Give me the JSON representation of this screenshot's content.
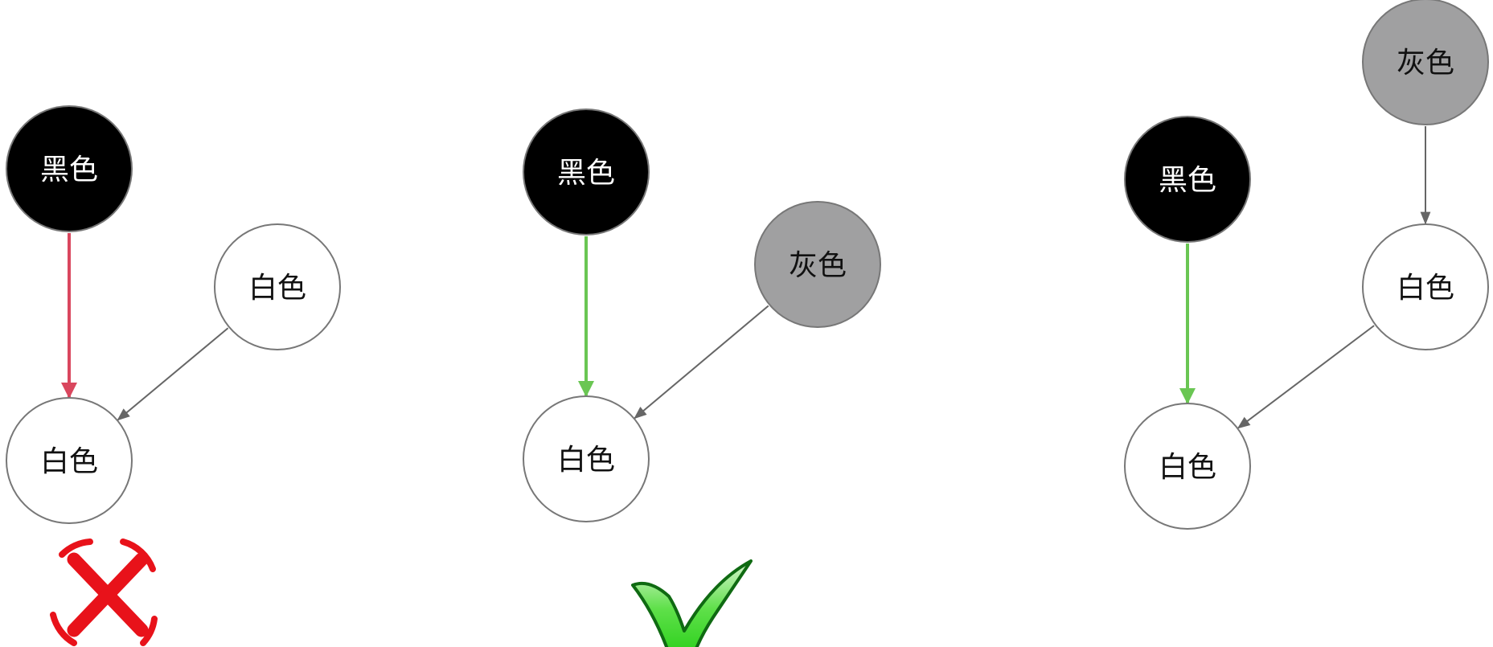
{
  "colors": {
    "black_node": "#000000",
    "white_node": "#ffffff",
    "gray_node": "#a0a0a1",
    "node_stroke": "#777777",
    "edge_gray": "#666666",
    "edge_red": "#d9475e",
    "edge_green": "#6ac653",
    "cross_red": "#e8121a",
    "check_green": "#33dd22"
  },
  "panels": [
    {
      "nodes": [
        {
          "id": "p1-black",
          "label": "黑色",
          "color": "black"
        },
        {
          "id": "p1-white-right",
          "label": "白色",
          "color": "white"
        },
        {
          "id": "p1-white-bottom",
          "label": "白色",
          "color": "white"
        }
      ],
      "edges": [
        {
          "from": "p1-black",
          "to": "p1-white-bottom",
          "style": "red"
        },
        {
          "from": "p1-white-right",
          "to": "p1-white-bottom",
          "style": "gray"
        }
      ],
      "verdict": "cross-icon"
    },
    {
      "nodes": [
        {
          "id": "p2-black",
          "label": "黑色",
          "color": "black"
        },
        {
          "id": "p2-gray-right",
          "label": "灰色",
          "color": "gray"
        },
        {
          "id": "p2-white-bottom",
          "label": "白色",
          "color": "white"
        }
      ],
      "edges": [
        {
          "from": "p2-black",
          "to": "p2-white-bottom",
          "style": "green"
        },
        {
          "from": "p2-gray-right",
          "to": "p2-white-bottom",
          "style": "gray"
        }
      ],
      "verdict": "checkmark-icon"
    },
    {
      "nodes": [
        {
          "id": "p3-gray-top",
          "label": "灰色",
          "color": "gray"
        },
        {
          "id": "p3-black",
          "label": "黑色",
          "color": "black"
        },
        {
          "id": "p3-white-right",
          "label": "白色",
          "color": "white"
        },
        {
          "id": "p3-white-bottom",
          "label": "白色",
          "color": "white"
        }
      ],
      "edges": [
        {
          "from": "p3-gray-top",
          "to": "p3-white-right",
          "style": "gray"
        },
        {
          "from": "p3-black",
          "to": "p3-white-bottom",
          "style": "green"
        },
        {
          "from": "p3-white-right",
          "to": "p3-white-bottom",
          "style": "gray"
        }
      ]
    }
  ]
}
